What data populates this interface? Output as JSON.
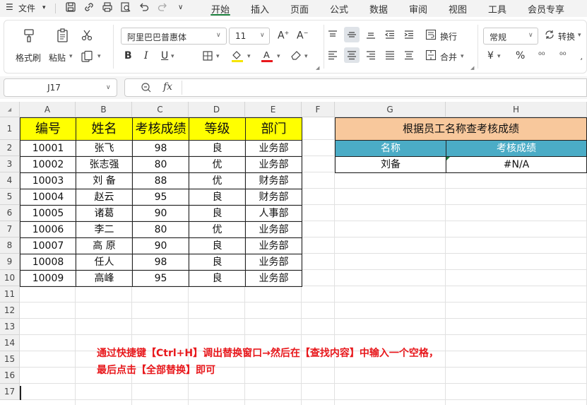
{
  "menubar": {
    "file_label": "文件",
    "tabs": [
      "开始",
      "插入",
      "页面",
      "公式",
      "数据",
      "审阅",
      "视图",
      "工具",
      "会员专享"
    ],
    "active_tab": "开始"
  },
  "ribbon": {
    "format_painter": "格式刷",
    "paste": "粘贴",
    "font_name": "阿里巴巴普惠体",
    "font_size": "11",
    "wrap": "换行",
    "merge": "合并",
    "number_format": "常规",
    "convert": "转换",
    "font_color_accent": "#e8181c",
    "fill_color_accent": "#f5e400"
  },
  "formula_bar": {
    "cell_ref": "J17",
    "fx_label": "fx",
    "content": ""
  },
  "sheet": {
    "columns": [
      "A",
      "B",
      "C",
      "D",
      "E",
      "F",
      "G",
      "H"
    ],
    "rows": [
      "1",
      "2",
      "3",
      "4",
      "5",
      "6",
      "7",
      "8",
      "9",
      "10",
      "11",
      "12",
      "13",
      "14",
      "15",
      "16",
      "17"
    ],
    "table_header": [
      "编号",
      "姓名",
      "考核成绩",
      "等级",
      "部门"
    ],
    "table_rows": [
      [
        "10001",
        "张飞",
        "98",
        "良",
        "业务部"
      ],
      [
        "10002",
        "张志强",
        "80",
        "优",
        "业务部"
      ],
      [
        "10003",
        "刘 备",
        "88",
        "优",
        "财务部"
      ],
      [
        "10004",
        "赵云",
        "95",
        "良",
        "财务部"
      ],
      [
        "10005",
        "诸葛",
        "90",
        "良",
        "人事部"
      ],
      [
        "10006",
        "李二",
        "80",
        "优",
        "业务部"
      ],
      [
        "10007",
        "高 原",
        "90",
        "良",
        "业务部"
      ],
      [
        "10008",
        "任人",
        "98",
        "良",
        "业务部"
      ],
      [
        "10009",
        "高峰",
        "95",
        "良",
        "业务部"
      ]
    ],
    "lookup_title": "根据员工名称查考核成绩",
    "lookup_header": [
      "名称",
      "考核成绩"
    ],
    "lookup_name": "刘备",
    "lookup_result": "#N/A",
    "header_fill": "#ffff00",
    "lookup_title_fill": "#f8c89c",
    "lookup_header_fill": "#4bacc6"
  },
  "note": {
    "line1": "通过快捷键【Ctrl+H】调出替换窗口→然后在【查找内容】中输入一个空格，",
    "line2": "最后点击【全部替换】即可"
  }
}
